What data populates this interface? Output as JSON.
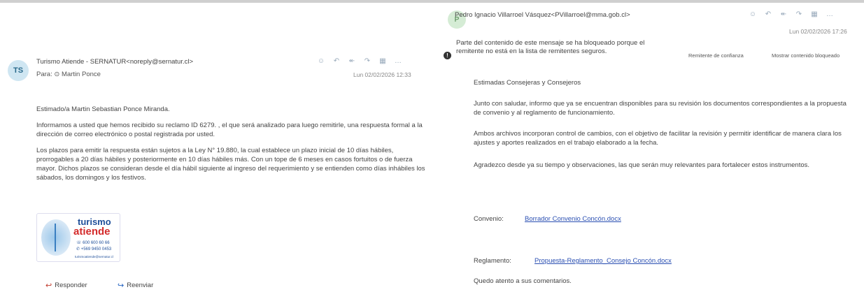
{
  "left_email": {
    "avatar_initials": "TS",
    "sender": "Turismo Atiende - SERNATUR<noreply@sernatur.cl>",
    "to_label": "Para: ⊙ Martin Ponce",
    "date": "Lun 02/02/2026 12:33",
    "action_icons": [
      "smile-icon",
      "reply-icon",
      "reply-all-icon",
      "forward-icon",
      "apps-icon",
      "more-icon"
    ],
    "greeting": "Estimado/a Martin Sebastian Ponce Miranda.",
    "para1": "Informamos a usted que hemos recibido su reclamo ID 6279. , el que será analizado para luego remitirle, una respuesta formal a la dirección de correo electrónico o postal registrada por usted.",
    "para2": "Los plazos para emitir la respuesta están sujetos a la Ley N° 19.880, la cual establece un plazo inicial de 10 días hábiles, prorrogables a 20 días hábiles y posteriormente en 10 días hábiles más. Con un tope de 6 meses en casos fortuitos o de fuerza mayor. Dichos plazos se consideran desde el día hábil siguiente al ingreso del requerimiento y se entienden como días inhábiles los sábados, los domingos y los festivos.",
    "logo": {
      "word1": "turismo",
      "word2": "atiende",
      "phone1": "☏ 600 600 60 66",
      "phone2": "✆ +569 9450 0453",
      "url": "turismoatiende@sernatur.cl"
    },
    "reply_label": "Responder",
    "forward_label": "Reenviar"
  },
  "right_email": {
    "avatar_initials": "P",
    "sender": "Pedro Ignacio Villarroel Vásquez<PVillarroel@mma.gob.cl>",
    "date": "Lun 02/02/2026 17:26",
    "blocked_notice": "Parte del contenido de este mensaje se ha bloqueado porque el remitente no está en la lista de remitentes seguros.",
    "trusted_sender_link": "Remitente de confianza",
    "show_blocked_link": "Mostrar contenido bloqueado",
    "greeting": "Estimadas Consejeras y Consejeros",
    "para1": "Junto con saludar, informo que ya se encuentran disponibles para su revisión los documentos correspondientes a la propuesta de convenio y al reglamento de funcionamiento.",
    "para2": "Ambos archivos incorporan control de cambios, con el objetivo de facilitar la revisión y permitir identificar de manera clara los ajustes y aportes realizados en el trabajo elaborado a la fecha.",
    "para3": "Agradezco desde ya su tiempo y observaciones, las que serán muy relevantes para fortalecer estos instrumentos.",
    "convenio_label": "Convenio:",
    "convenio_link": "Borrador Convenio Concón.docx",
    "reglamento_label": "Reglamento:",
    "reglamento_link": "Propuesta-Reglamento_Consejo Concón.docx",
    "closing": "Quedo atento a sus comentarios."
  }
}
